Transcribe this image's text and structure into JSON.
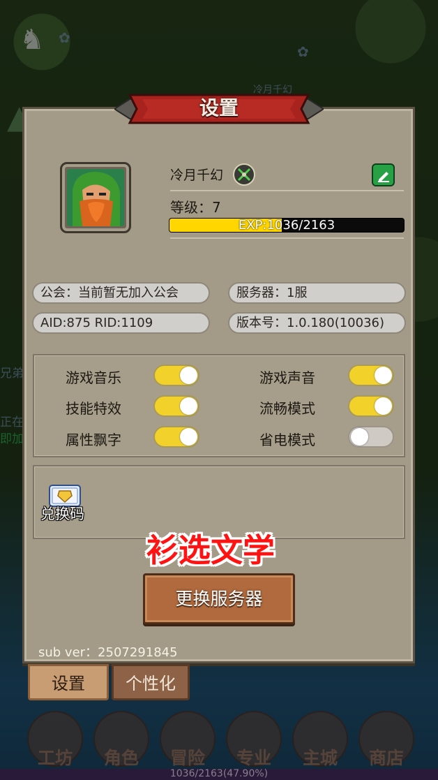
{
  "dialog": {
    "title": "设置"
  },
  "player": {
    "name": "冷月千幻",
    "level_text": "等级：7",
    "exp_text": "EXP:1036/2163",
    "exp_fraction": 0.479
  },
  "info": {
    "guild": "公会：当前暂无加入公会",
    "server": "服务器：1服",
    "ids": "AID:875  RID:1109",
    "version": "版本号：1.0.180(10036)"
  },
  "settings": [
    {
      "label": "游戏音乐",
      "on": true
    },
    {
      "label": "游戏声音",
      "on": true
    },
    {
      "label": "技能特效",
      "on": true
    },
    {
      "label": "流畅模式",
      "on": true
    },
    {
      "label": "属性飘字",
      "on": true
    },
    {
      "label": "省电模式",
      "on": false
    }
  ],
  "redeem": {
    "label": "兑换码"
  },
  "watermark": "衫选文学",
  "switch_server_label": "更换服务器",
  "sub_version": "sub ver：2507291845",
  "tabs": [
    {
      "label": "设置",
      "active": true
    },
    {
      "label": "个性化",
      "active": false
    }
  ],
  "bottom_nav": [
    "工坊",
    "角色",
    "冒险",
    "专业",
    "主城",
    "商店"
  ],
  "bottom_exp": "1036/2163(47.90%)",
  "background_texts": [
    "冷月千幻",
    "兄弟",
    "正在",
    "即加"
  ],
  "colors": {
    "toggle_on": "#f2d22a",
    "toggle_off": "#cfcac4",
    "exp_fill": "#ffd600",
    "edit_button": "#28a046",
    "title_banner": "#a8221e"
  }
}
